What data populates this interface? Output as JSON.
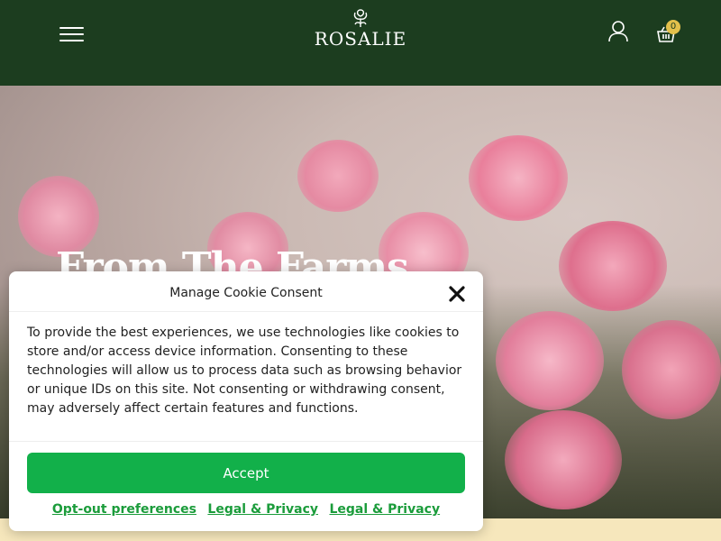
{
  "header": {
    "logo_text": "ROSALIE",
    "cart_count": "0",
    "colors": {
      "background": "#1c3d1f",
      "badge": "#e3c04b"
    },
    "icons": [
      "hamburger-menu-icon",
      "rose-logo-icon",
      "account-icon",
      "cart-icon"
    ]
  },
  "hero": {
    "title": "From The Farms"
  },
  "cookie": {
    "title": "Manage Cookie Consent",
    "body": "To provide the best experiences, we use technologies like cookies to store and/or access device information. Consenting to these technologies will allow us to process data such as browsing behavior or unique IDs on this site. Not consenting or withdrawing consent, may adversely affect certain features and functions.",
    "accept_label": "Accept",
    "links": [
      "Opt-out preferences",
      "Legal & Privacy",
      "Legal & Privacy"
    ],
    "colors": {
      "accept": "#12b04a",
      "link": "#1b9c3b"
    }
  }
}
